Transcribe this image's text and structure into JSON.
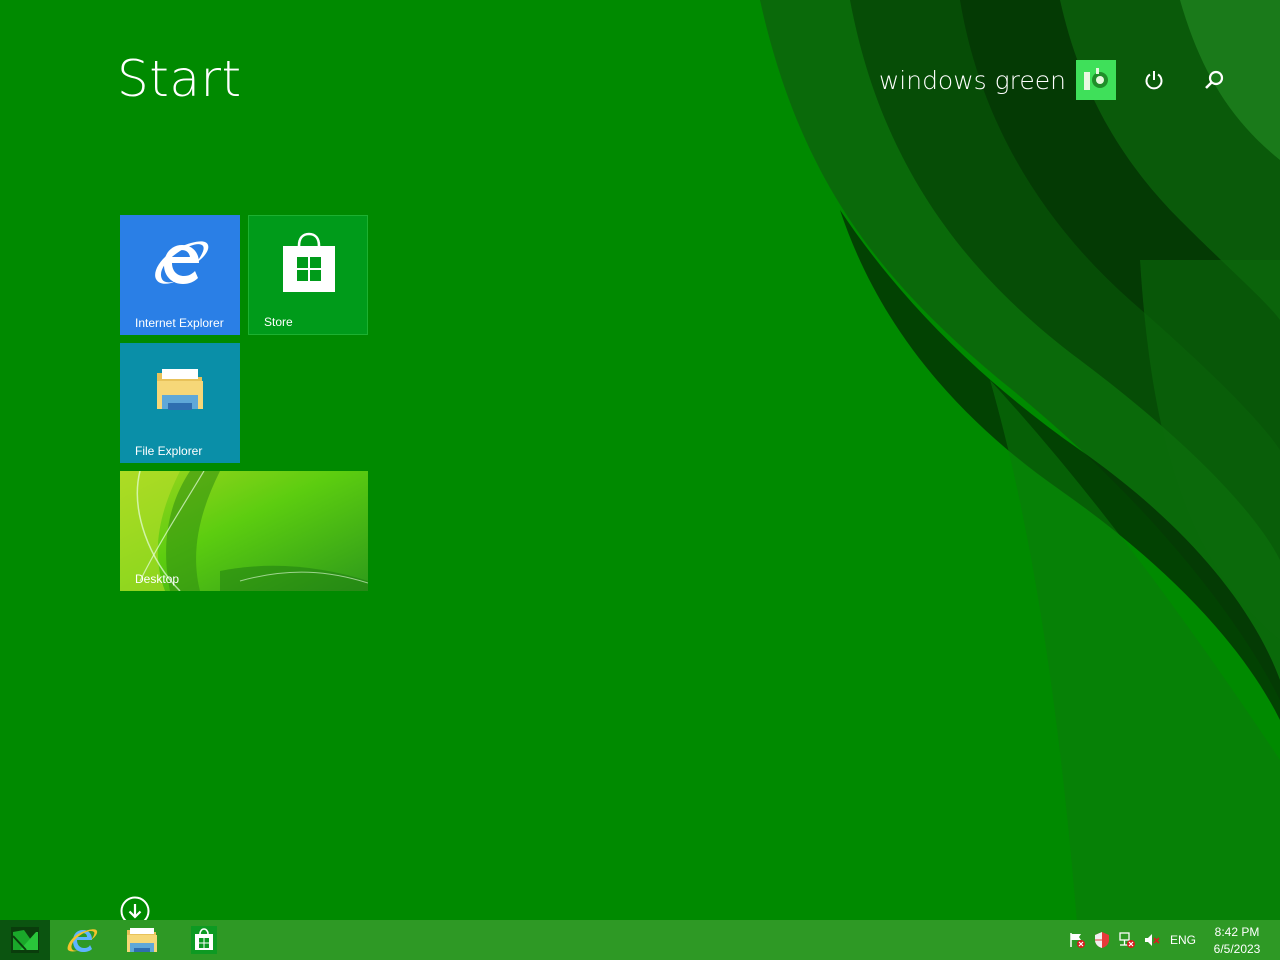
{
  "start": {
    "title": "Start"
  },
  "user": {
    "name": "windows green"
  },
  "tiles": {
    "ie": {
      "label": "Internet Explorer"
    },
    "store": {
      "label": "Store"
    },
    "explorer": {
      "label": "File Explorer"
    },
    "desktop": {
      "label": "Desktop"
    }
  },
  "tray": {
    "language": "ENG"
  },
  "clock": {
    "time": "8:42 PM",
    "date": "6/5/2023"
  },
  "colors": {
    "background": "#008a00",
    "taskbar": "#2e9925",
    "ie_tile": "#2a7fe6",
    "store_tile": "#009b1a",
    "explorer_tile": "#0a8fa8",
    "avatar": "#3fe05a"
  },
  "icons": [
    "power-icon",
    "search-icon",
    "internet-explorer-icon",
    "store-icon",
    "file-explorer-icon",
    "down-arrow-icon",
    "windows-start-icon",
    "flag-icon",
    "shield-icon",
    "network-icon",
    "volume-icon"
  ]
}
